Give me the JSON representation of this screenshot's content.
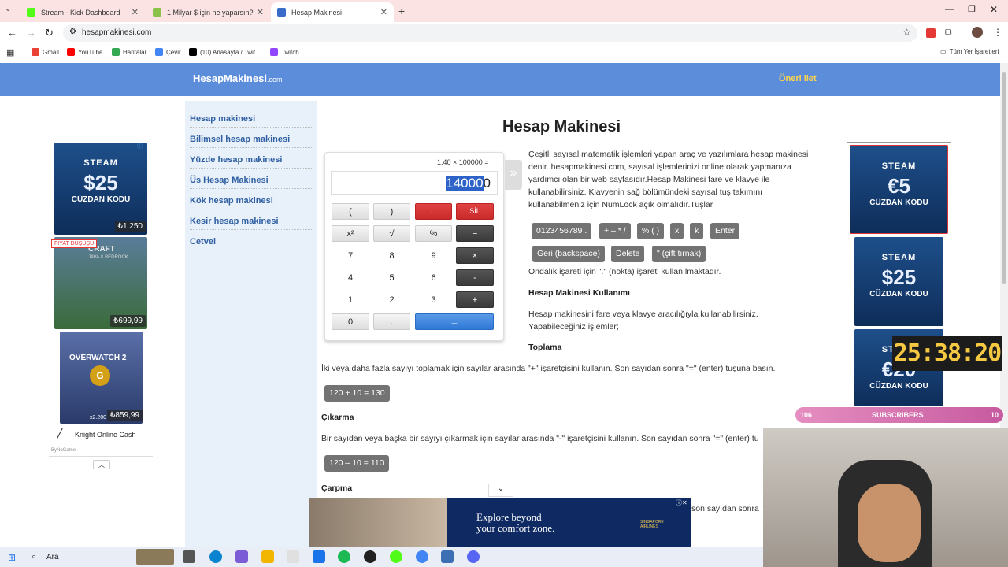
{
  "browser": {
    "tabs": [
      {
        "title": "Stream - Kick Dashboard",
        "color": "#53fc18"
      },
      {
        "title": "1 Milyar $ için ne yaparsın? - Tr",
        "color": "#8bc34a"
      },
      {
        "title": "Hesap Makinesi",
        "color": "#3a6bc8"
      }
    ],
    "url": "hesapmakinesi.com",
    "bookmarks": [
      {
        "label": "Gmail",
        "color": "#ea4335"
      },
      {
        "label": "YouTube",
        "color": "#ff0000"
      },
      {
        "label": "Haritalar",
        "color": "#34a853"
      },
      {
        "label": "Çevir",
        "color": "#4285f4"
      },
      {
        "label": "(10) Anasayfa / Twit...",
        "color": "#000000"
      },
      {
        "label": "Twitch",
        "color": "#9146ff"
      }
    ],
    "all_bookmarks": "Tüm Yer İşaretleri"
  },
  "site": {
    "logo": "HesapMakinesi",
    "logo_suffix": ".com",
    "suggest": "Öneri ilet",
    "nav": [
      "Hesap makinesi",
      "Bilimsel hesap makinesi",
      "Yüzde hesap makinesi",
      "Üs Hesap Makinesi",
      "Kök hesap makinesi",
      "Kesir hesap makinesi",
      "Cetvel"
    ],
    "title": "Hesap Makinesi"
  },
  "calculator": {
    "expression": "1.40  ×  100000  =",
    "display_selected": "14000",
    "display_rest": "0",
    "keys": [
      [
        "(",
        ")",
        "←",
        "SİL"
      ],
      [
        "x²",
        "√",
        "%",
        "÷"
      ],
      [
        "7",
        "8",
        "9",
        "×"
      ],
      [
        "4",
        "5",
        "6",
        "-"
      ],
      [
        "1",
        "2",
        "3",
        "+"
      ],
      [
        "0",
        ".",
        "="
      ]
    ]
  },
  "content": {
    "intro": "Çeşitli sayısal matematik işlemleri yapan araç ve yazılımlara hesap makinesi denir. hesapmakinesi.com, sayısal işlemlerinizi online olarak yapmanıza yardımcı olan bir web sayfasıdır.Hesap Makinesi fare ve klavye ile kullanabilirsiniz. Klavyenin sağ bölümündeki sayısal tuş takımını kullanabilmeniz için NumLock açık olmalıdır.Tuşlar",
    "keys_row1": [
      "0123456789 .",
      "+ – * /",
      "% ( )",
      "x",
      "k",
      "Enter"
    ],
    "keys_row2": [
      "Geri (backspace)",
      "Delete",
      "\" (çift tırnak)"
    ],
    "decimal_note": "Ondalık işareti için \".\" (nokta) işareti kullanılmaktadır.",
    "usage_title": "Hesap Makinesi Kullanımı",
    "usage_text": "Hesap makinesini fare veya klavye aracılığıyla kullanabilirsiniz. Yapabileceğiniz işlemler;",
    "add_title": "Toplama",
    "add_text": "İki veya daha fazla sayıyı toplamak için sayılar arasında \"+\" işaretçisini kullanın. Son sayıdan sonra \"=\" (enter) tuşuna basın.",
    "add_example": "120 + 10 = 130",
    "sub_title": "Çıkarma",
    "sub_text": "Bir sayıdan veya başka bir sayıyı çıkarmak için sayılar arasında \"-\" işaretçisini kullanın. Son sayıdan sonra \"=\" (enter) tu",
    "sub_example": "120 – 10 = 110",
    "mul_title": "Çarpma",
    "mul_text_tail": "son sayıdan sonra \""
  },
  "ads": {
    "left": [
      {
        "brand": "STEAM",
        "amount": "$25",
        "label": "CÜZDAN KODU",
        "price": "₺1.250"
      },
      {
        "badge": "FIYAT DÜŞÜŞÜ",
        "brand": "CRAFT",
        "sub": "JAVA & BEDROCK",
        "price": "₺699,99"
      },
      {
        "brand": "OVERWATCH 2",
        "coins": "x2.200",
        "price": "₺859,99"
      }
    ],
    "left_footer": "Knight Online Cash",
    "left_by": "ByNoGame",
    "right": [
      {
        "brand": "STEAM",
        "amount": "€5",
        "label": "CÜZDAN KODU"
      },
      {
        "brand": "STEAM",
        "amount": "$25",
        "label": "CÜZDAN KODU"
      },
      {
        "brand": "STEAM",
        "amount": "€20",
        "label": "CÜZDAN KODU"
      }
    ],
    "bottom": {
      "line1": "Explore beyond",
      "line2": "your comfort zone.",
      "brand": "SINGAPORE AIRLINES"
    }
  },
  "stream_overlay": {
    "timer": "25:38:20",
    "sub_left": "106",
    "sub_label": "SUBSCRIBERS",
    "sub_right": "10"
  },
  "taskbar": {
    "search": "Ara"
  }
}
